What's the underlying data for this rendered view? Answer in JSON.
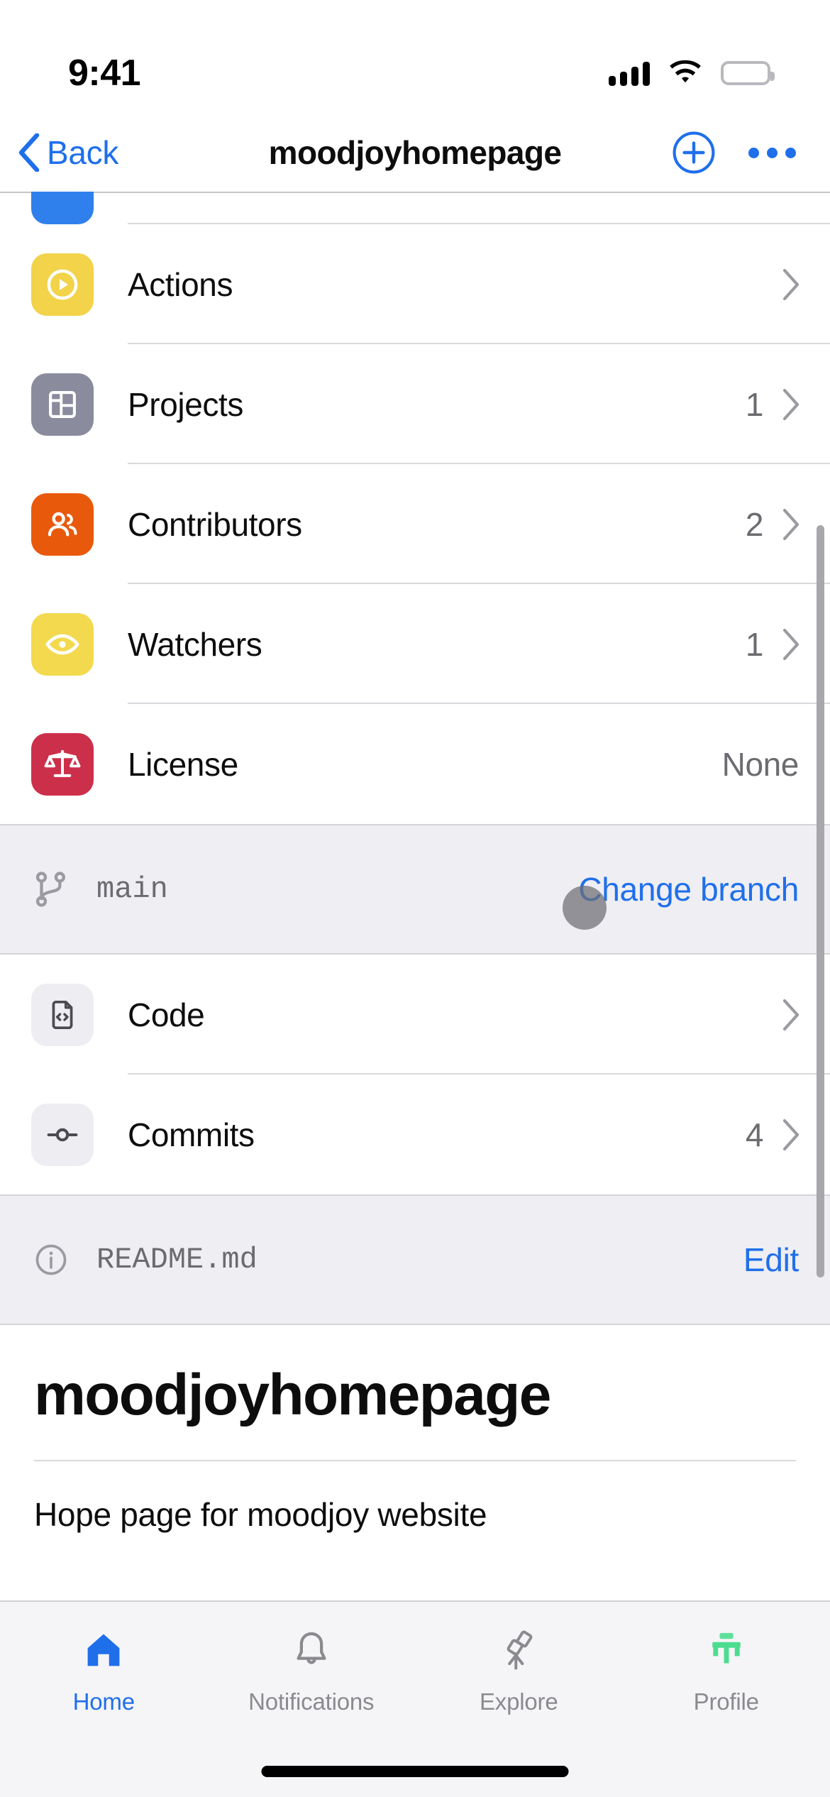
{
  "status_bar": {
    "time": "9:41",
    "cellular_icon": "cellular-signal-icon",
    "wifi_icon": "wifi-icon",
    "battery_icon": "battery-full-icon"
  },
  "nav_bar": {
    "back_label": "Back",
    "back_icon": "chevron-left-icon",
    "title": "moodjoyhomepage",
    "add_icon": "plus-circle-icon",
    "more_icon": "ellipsis-icon",
    "accent_color": "#1f6feb"
  },
  "repo_rows": [
    {
      "label": "Actions",
      "value": "",
      "icon": "play-circle-icon",
      "icon_bg": "#f2d349",
      "icon_fg": "#ffffff",
      "has_chevron": true
    },
    {
      "label": "Projects",
      "value": "1",
      "icon": "project-board-icon",
      "icon_bg": "#8b8b9e",
      "icon_fg": "#ffffff",
      "has_chevron": true
    },
    {
      "label": "Contributors",
      "value": "2",
      "icon": "people-icon",
      "icon_bg": "#e8590c",
      "icon_fg": "#ffffff",
      "has_chevron": true
    },
    {
      "label": "Watchers",
      "value": "1",
      "icon": "eye-icon",
      "icon_bg": "#f2d94e",
      "icon_fg": "#ffffff",
      "has_chevron": true
    },
    {
      "label": "License",
      "value": "None",
      "icon": "law-scales-icon",
      "icon_bg": "#cc2f4a",
      "icon_fg": "#ffffff",
      "has_chevron": false
    }
  ],
  "branch_bar": {
    "icon": "git-branch-icon",
    "branch_name": "main",
    "change_link": "Change branch",
    "link_color": "#1f6feb"
  },
  "code_rows": [
    {
      "label": "Code",
      "value": "",
      "icon": "file-code-icon",
      "icon_bg": "#eeeef2",
      "icon_fg": "#4b4b52",
      "has_chevron": true
    },
    {
      "label": "Commits",
      "value": "4",
      "icon": "git-commit-icon",
      "icon_bg": "#eeeef2",
      "icon_fg": "#4b4b52",
      "has_chevron": true
    }
  ],
  "readme_bar": {
    "icon": "info-circle-icon",
    "filename": "README.md",
    "edit_label": "Edit",
    "link_color": "#1f6feb"
  },
  "readme_body": {
    "heading": "moodjoyhomepage",
    "paragraph": "Hope page for moodjoy website"
  },
  "tab_bar": [
    {
      "label": "Home",
      "icon": "home-icon",
      "active": true
    },
    {
      "label": "Notifications",
      "icon": "bell-icon",
      "active": false
    },
    {
      "label": "Explore",
      "icon": "telescope-icon",
      "active": false
    },
    {
      "label": "Profile",
      "icon": "avatar-image-icon",
      "active": false
    }
  ]
}
